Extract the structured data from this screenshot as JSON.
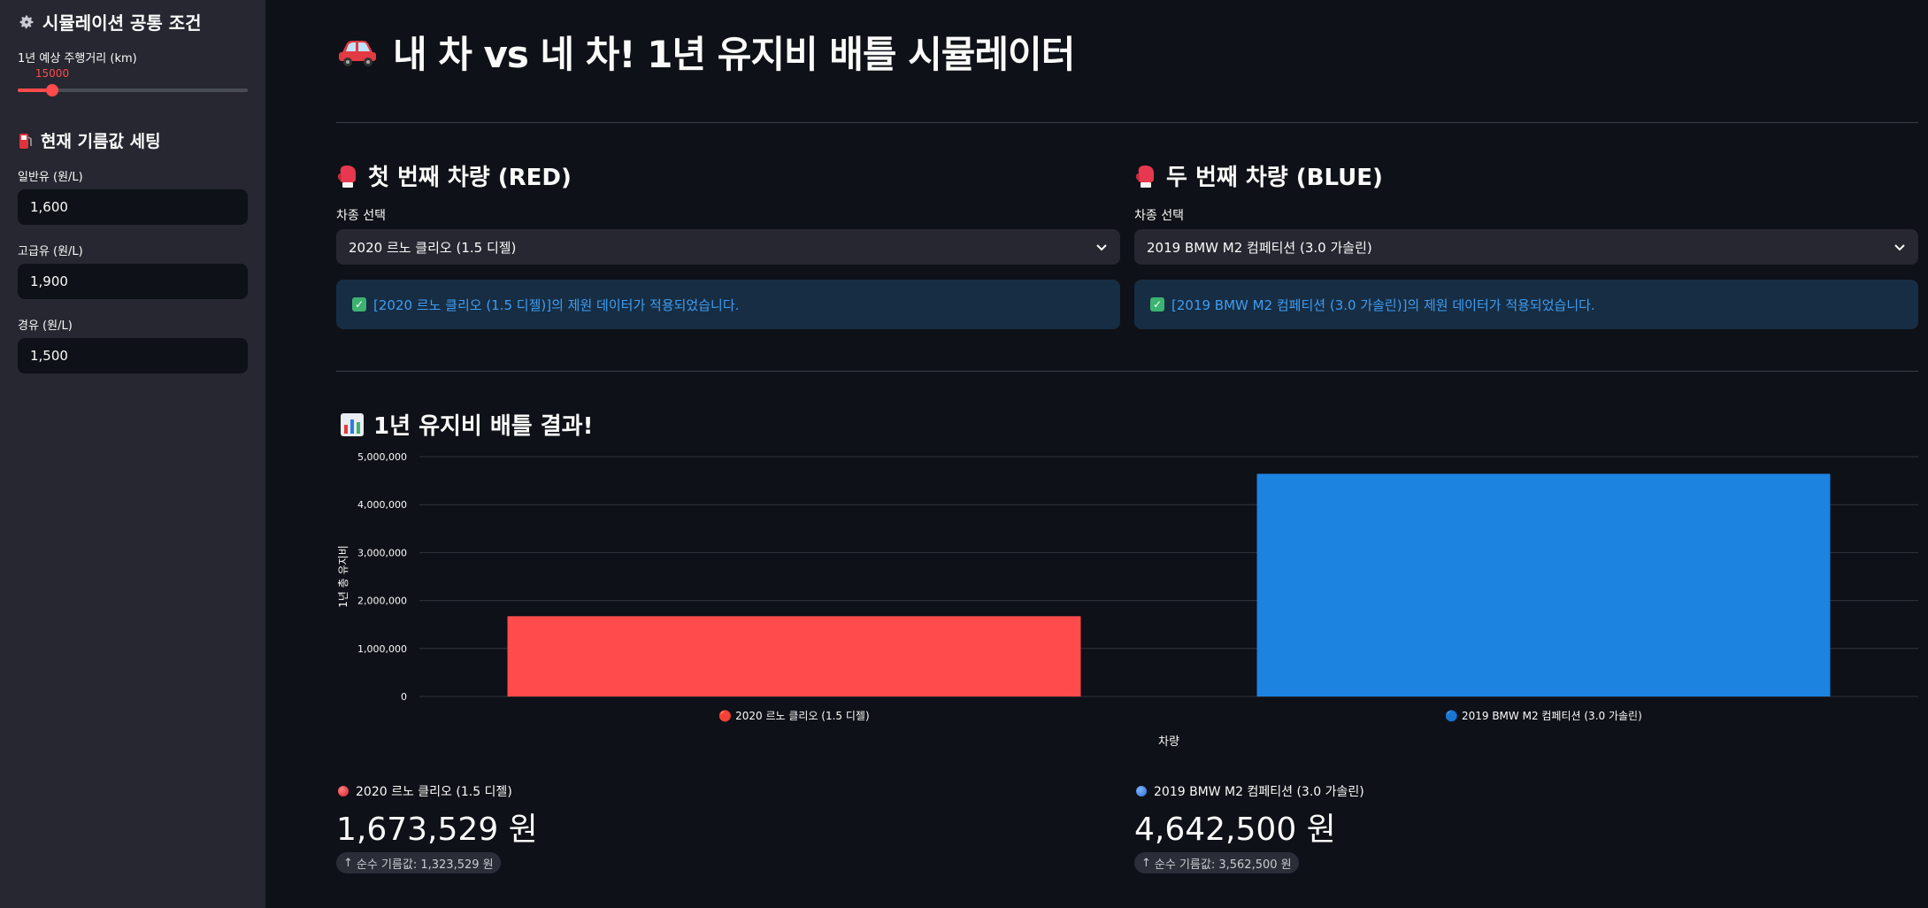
{
  "sidebar": {
    "common_title": "시뮬레이션 공통 조건",
    "common_icon": "gear-icon",
    "distance": {
      "label": "1년 예상 주행거리 (km)",
      "value": 15000,
      "value_text": "15000",
      "min": 0,
      "max": 100000
    },
    "fuel_title": "현재 기름값 세팅",
    "fuel_icon": "fuel-pump-icon",
    "fuels": [
      {
        "label": "일반유 (원/L)",
        "value": "1,600"
      },
      {
        "label": "고급유 (원/L)",
        "value": "1,900"
      },
      {
        "label": "경유 (원/L)",
        "value": "1,500"
      }
    ]
  },
  "main": {
    "title": "내 차 vs 네 차! 1년 유지비 배틀 시뮬레이터",
    "title_icon": "car-icon",
    "cars": [
      {
        "heading": "첫 번째 차량 (RED)",
        "icon": "boxing-glove-icon",
        "select_label": "차종 선택",
        "selected": "2020 르노 클리오 (1.5 디젤)",
        "info": "[2020 르노 클리오 (1.5 디젤)]의 제원 데이터가 적용되었습니다."
      },
      {
        "heading": "두 번째 차량 (BLUE)",
        "icon": "boxing-glove-icon",
        "select_label": "차종 선택",
        "selected": "2019 BMW M2 컴페티션 (3.0 가솔린)",
        "info": "[2019 BMW M2 컴페티션 (3.0 가솔린)]의 제원 데이터가 적용되었습니다."
      }
    ],
    "result_title": "1년 유지비 배틀 결과!",
    "result_icon": "bar-chart-icon",
    "metrics": [
      {
        "label": "2020 르노 클리오 (1.5 디젤)",
        "value": "1,673,529 원",
        "delta": "순수 기름값: 1,323,529 원"
      },
      {
        "label": "2019 BMW M2 컴페티션 (3.0 가솔린)",
        "value": "4,642,500 원",
        "delta": "순수 기름값: 3,562,500 원"
      }
    ]
  },
  "chart_data": {
    "type": "bar",
    "categories": [
      "🔴 2020 르노 클리오 (1.5 디젤)",
      "🔵 2019 BMW M2 컴페티션 (3.0 가솔린)"
    ],
    "values": [
      1673529,
      4642500
    ],
    "colors": [
      "#ff4b4b",
      "#1c83e1"
    ],
    "xlabel": "차량",
    "ylabel": "1년 총 유지비",
    "ylim": [
      0,
      5000000
    ],
    "yticks": [
      0,
      1000000,
      2000000,
      3000000,
      4000000,
      5000000
    ],
    "ytick_labels": [
      "0",
      "1,000,000",
      "2,000,000",
      "3,000,000",
      "4,000,000",
      "5,000,000"
    ],
    "grid": true
  }
}
